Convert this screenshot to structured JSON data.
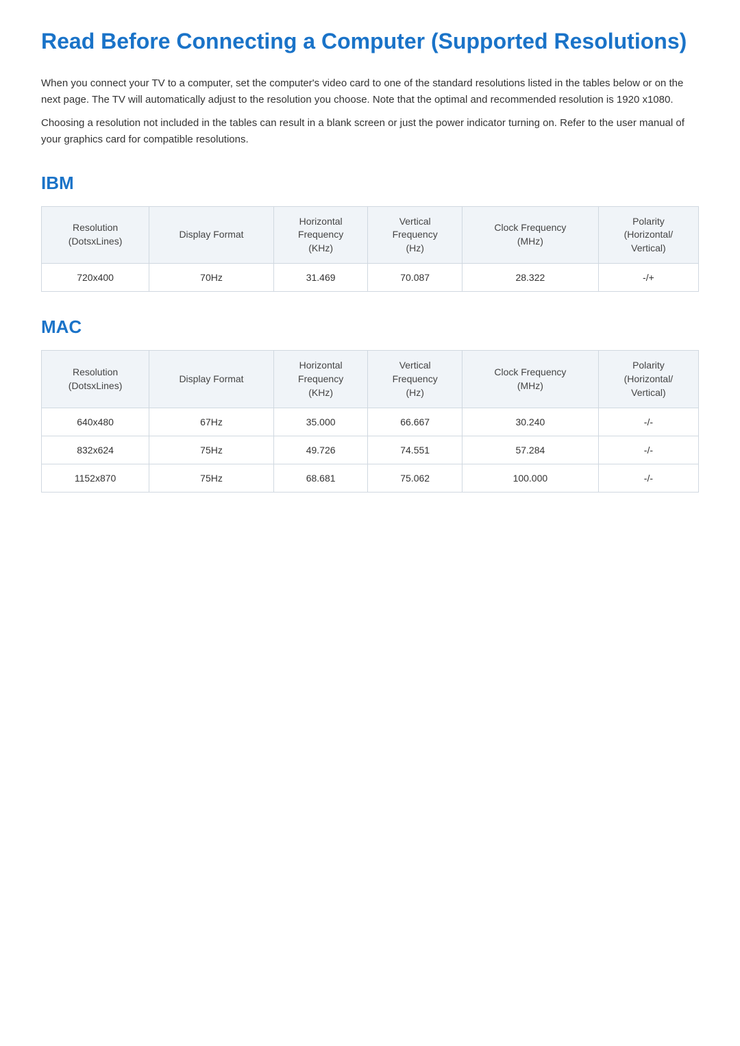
{
  "page": {
    "title": "Read Before Connecting a Computer (Supported Resolutions)",
    "intro": [
      "When you connect your TV to a computer, set the computer's video card to one of the standard resolutions listed in the tables below or on the next page. The TV will automatically adjust to the resolution you choose. Note that the optimal and recommended resolution is 1920 x1080.",
      "Choosing a resolution not included in the tables can result in a blank screen or just the power indicator turning on. Refer to the user manual of your graphics card for compatible resolutions."
    ]
  },
  "ibm_section": {
    "title": "IBM",
    "table": {
      "headers": [
        "Resolution\n(DotsxLines)",
        "Display Format",
        "Horizontal\nFrequency\n(KHz)",
        "Vertical\nFrequency\n(Hz)",
        "Clock Frequency\n(MHz)",
        "Polarity\n(Horizontal/\nVertical)"
      ],
      "rows": [
        {
          "resolution": "720x400",
          "display_format": "70Hz",
          "h_freq": "31.469",
          "v_freq": "70.087",
          "clock_freq": "28.322",
          "polarity": "-/+"
        }
      ]
    }
  },
  "mac_section": {
    "title": "MAC",
    "table": {
      "headers": [
        "Resolution\n(DotsxLines)",
        "Display Format",
        "Horizontal\nFrequency\n(KHz)",
        "Vertical\nFrequency\n(Hz)",
        "Clock Frequency\n(MHz)",
        "Polarity\n(Horizontal/\nVertical)"
      ],
      "rows": [
        {
          "resolution": "640x480",
          "display_format": "67Hz",
          "h_freq": "35.000",
          "v_freq": "66.667",
          "clock_freq": "30.240",
          "polarity": "-/-"
        },
        {
          "resolution": "832x624",
          "display_format": "75Hz",
          "h_freq": "49.726",
          "v_freq": "74.551",
          "clock_freq": "57.284",
          "polarity": "-/-"
        },
        {
          "resolution": "1152x870",
          "display_format": "75Hz",
          "h_freq": "68.681",
          "v_freq": "75.062",
          "clock_freq": "100.000",
          "polarity": "-/-"
        }
      ]
    }
  }
}
